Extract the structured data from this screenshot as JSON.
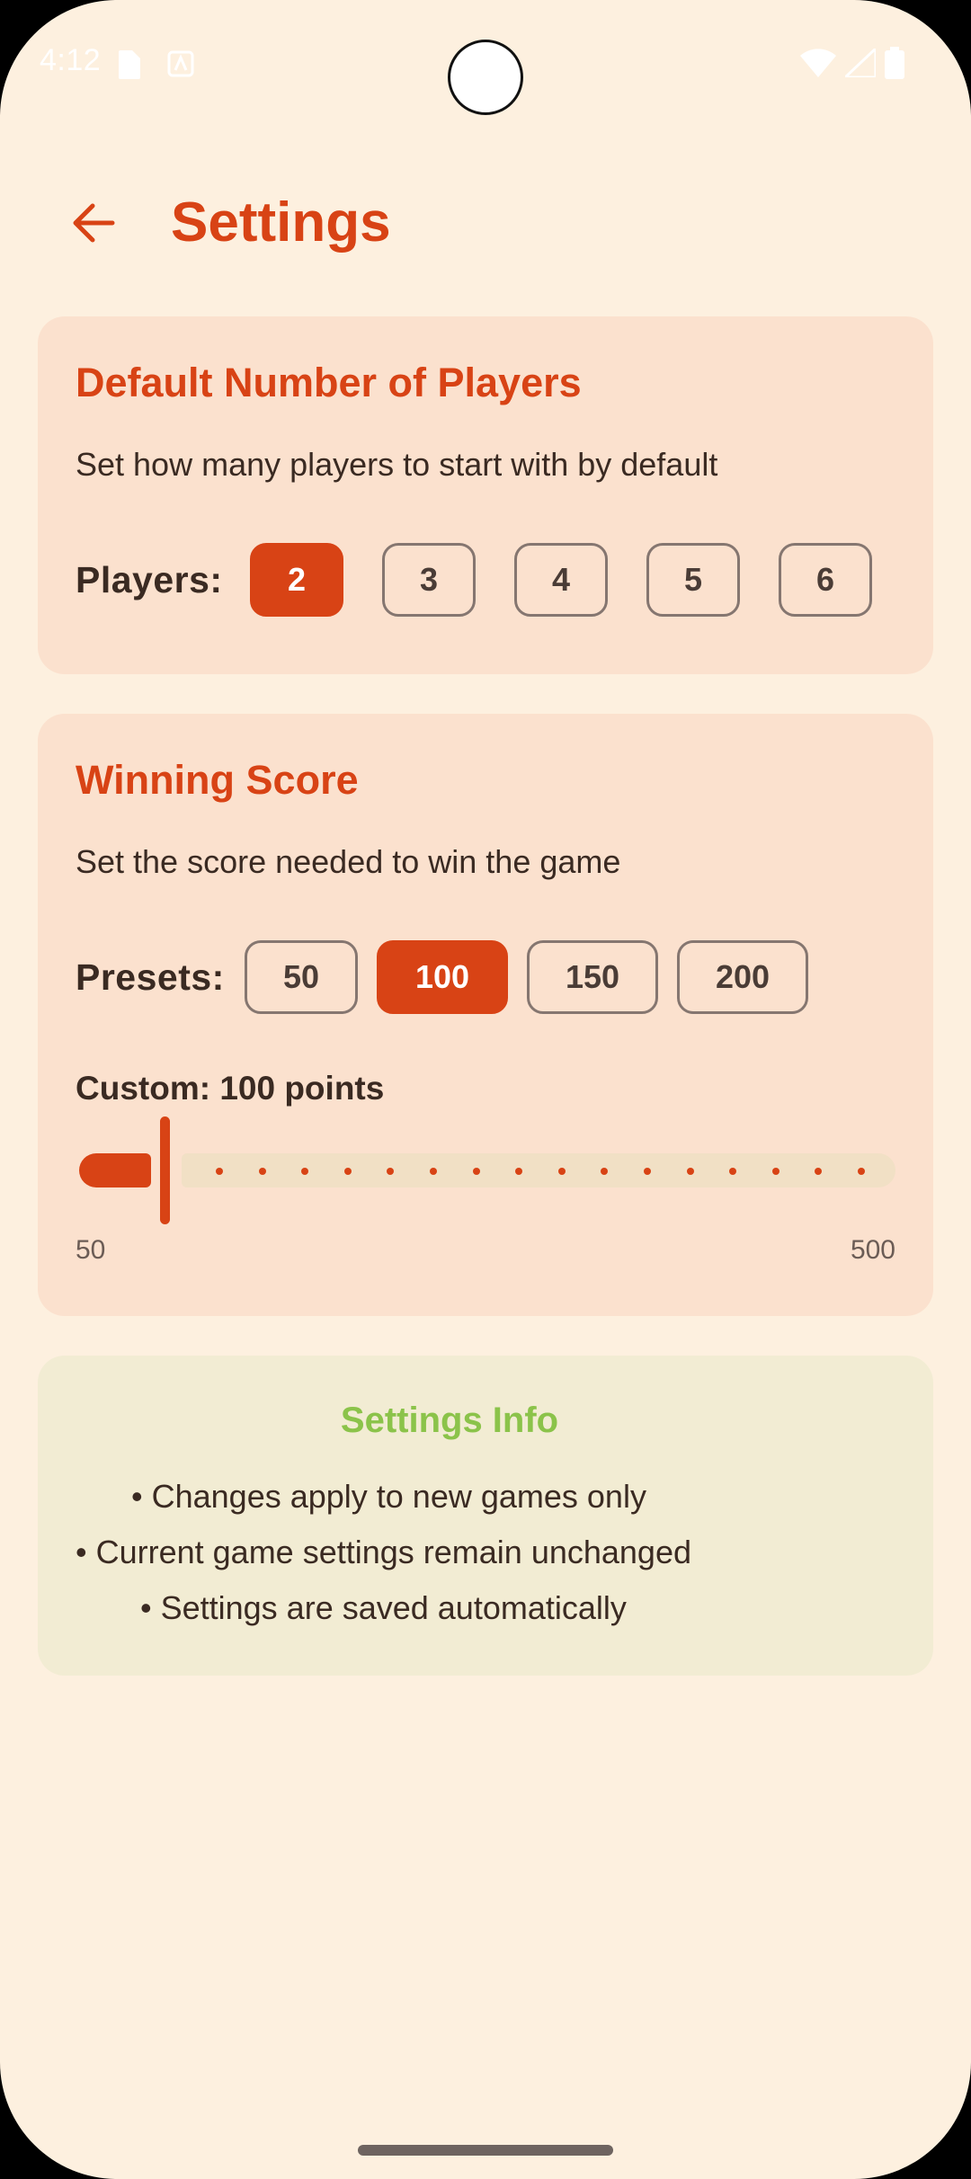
{
  "status_bar": {
    "time": "4:12",
    "icons": [
      "sim-card-icon",
      "android-icon",
      "wifi-icon",
      "signal-icon",
      "battery-icon"
    ]
  },
  "app_bar": {
    "title": "Settings",
    "back_icon": "arrow-back-icon"
  },
  "players_card": {
    "title": "Default Number of Players",
    "description": "Set how many players to start with by default",
    "label": "Players:",
    "options": [
      "2",
      "3",
      "4",
      "5",
      "6"
    ],
    "selected": "2"
  },
  "score_card": {
    "title": "Winning Score",
    "description": "Set the score needed to win the game",
    "presets_label": "Presets:",
    "presets": [
      "50",
      "100",
      "150",
      "200"
    ],
    "selected": "100",
    "custom_label": "Custom: 100 points",
    "slider": {
      "value": 100,
      "min": 50,
      "max": 500,
      "min_label": "50",
      "max_label": "500"
    }
  },
  "info_card": {
    "title": "Settings Info",
    "lines": [
      "• Changes apply to new games only",
      "• Current game settings remain unchanged",
      "• Settings are saved automatically"
    ]
  },
  "colors": {
    "background": "#FDF0DF",
    "accent": "#D84315",
    "card": "#FBE1CE",
    "info_card": "#F2ECD3",
    "info_title": "#8BC34A"
  }
}
